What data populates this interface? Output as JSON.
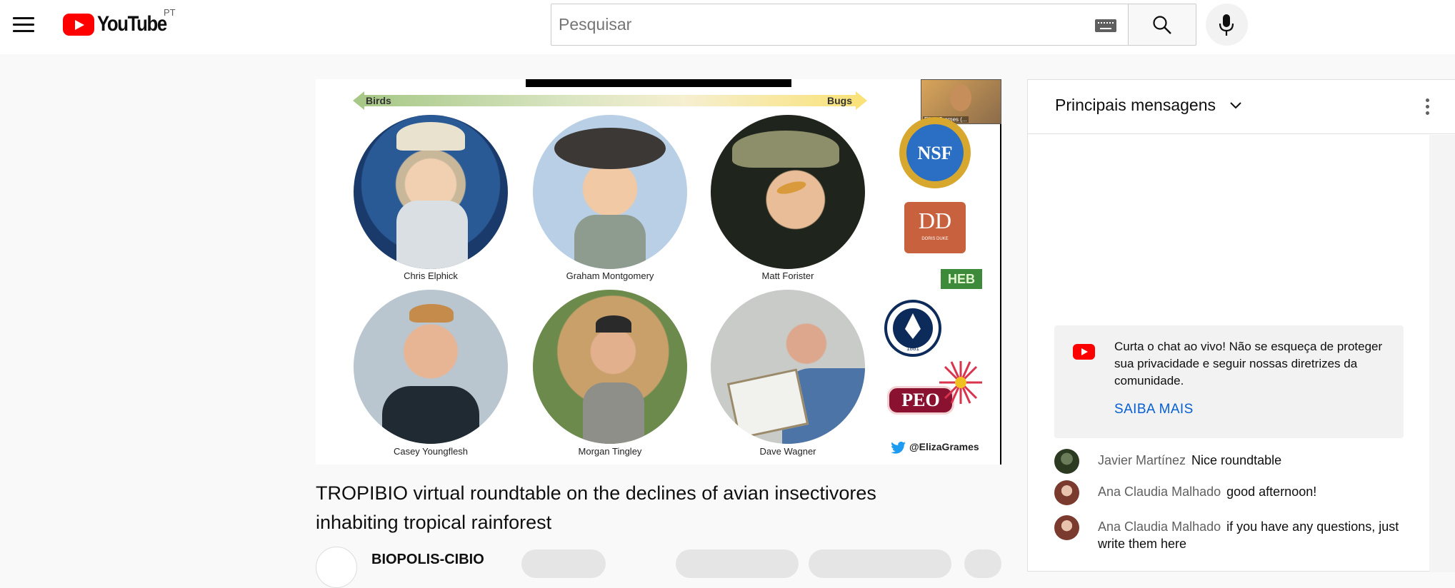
{
  "header": {
    "logo_text": "YouTube",
    "country_code": "PT",
    "search_placeholder": "Pesquisar"
  },
  "slide": {
    "left_label": "Birds",
    "right_label": "Bugs",
    "panelists": [
      {
        "name": "Chris Elphick"
      },
      {
        "name": "Graham Montgomery"
      },
      {
        "name": "Matt Forister"
      },
      {
        "name": "Casey Youngflesh"
      },
      {
        "name": "Morgan Tingley"
      },
      {
        "name": "Dave Wagner"
      }
    ],
    "pip_label": "Eliza Grames (...",
    "sponsor_logos": {
      "nsf": "NSF",
      "dd": "DD",
      "dd_sub": "DORIS DUKE",
      "heb": "HEB",
      "uconn_year": "1881",
      "peo": "PEO"
    },
    "twitter_handle": "@ElizaGrames"
  },
  "video": {
    "title_line1": "TROPIBIO virtual roundtable on the declines of avian insectivores",
    "title_line2": "inhabiting tropical rainforest",
    "channel_name": "BIOPOLIS-CIBIO"
  },
  "chat": {
    "header_title": "Principais mensagens",
    "notice_text": "Curta o chat ao vivo! Não se esqueça de proteger sua privacidade e seguir nossas diretrizes da comunidade.",
    "notice_link": "SAIBA MAIS",
    "messages": [
      {
        "author": "Javier Martínez",
        "text": "Nice roundtable"
      },
      {
        "author": "Ana Claudia Malhado",
        "text": "good afternoon!"
      },
      {
        "author": "Ana Claudia Malhado",
        "text": "if you have any questions, just write them here"
      }
    ]
  },
  "colors": {
    "brand_red": "#ff0000",
    "link_blue": "#065fd4",
    "twitter_blue": "#1d9bf0"
  }
}
